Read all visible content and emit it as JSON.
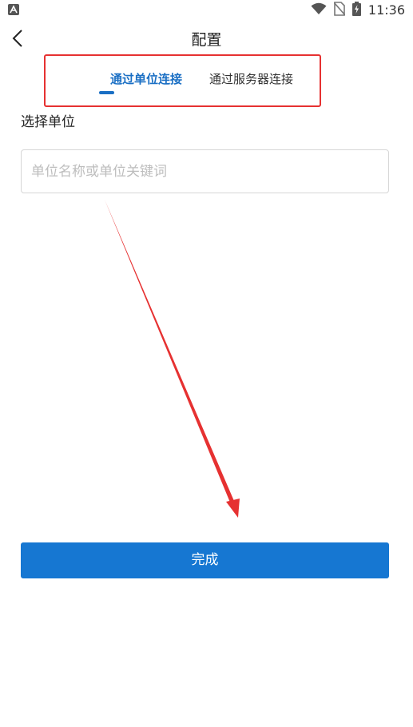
{
  "status_bar": {
    "time": "11:36",
    "icons": [
      "app-notification-icon",
      "wifi-icon",
      "no-sim-icon",
      "battery-charging-icon"
    ]
  },
  "header": {
    "title": "配置",
    "back_icon": "back-arrow-icon"
  },
  "tabs": [
    {
      "label": "通过单位连接",
      "active": true
    },
    {
      "label": "通过服务器连接",
      "active": false
    }
  ],
  "form": {
    "section_label": "选择单位",
    "input_placeholder": "单位名称或单位关键词",
    "input_value": ""
  },
  "actions": {
    "done_label": "完成"
  },
  "colors": {
    "accent": "#1a6fc4",
    "button": "#1677d2",
    "annotation": "#e63131"
  }
}
